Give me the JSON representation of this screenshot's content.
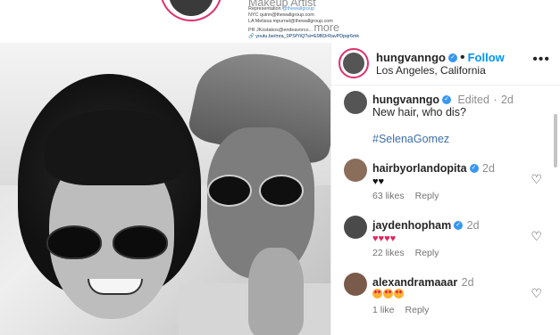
{
  "profile_bio": {
    "role": "Makeup Artist",
    "representation_label": "Representation",
    "representation_handle": "@thewallgroup",
    "nyc": "NYC quinn@thewallgroup.com",
    "la": "LA Melissa mpurnel@thewallgroup.com",
    "pr": "PR JKostakos@endeavorco...",
    "more": "more",
    "link": "youtu.be/mra_0PSfYiQ?si=E9BDrRavPDpqr6mk"
  },
  "post": {
    "author": "hungvanngo",
    "follow_label": "Follow",
    "location": "Los Angeles, California",
    "more_menu": "•••",
    "caption": {
      "author": "hungvanngo",
      "edited": "Edited",
      "time": "2d",
      "text": "New hair, who dis?",
      "hashtag": "#SelenaGomez"
    }
  },
  "comments": [
    {
      "user": "hairbyorlandopita",
      "time": "2d",
      "emoji": "black-hearts",
      "likes": "63 likes",
      "reply": "Reply"
    },
    {
      "user": "jaydenhopham",
      "time": "2d",
      "emoji": "red-hearts",
      "likes": "22 likes",
      "reply": "Reply"
    },
    {
      "user": "alexandramaaar",
      "time": "2d",
      "emoji": "heart-eyes",
      "likes": "1 like",
      "reply": "Reply"
    }
  ],
  "colors": {
    "accent": "#0095f6",
    "verified": "#3897f0",
    "story_ring": "#e1306c",
    "hashtag": "#3e6ea8"
  }
}
